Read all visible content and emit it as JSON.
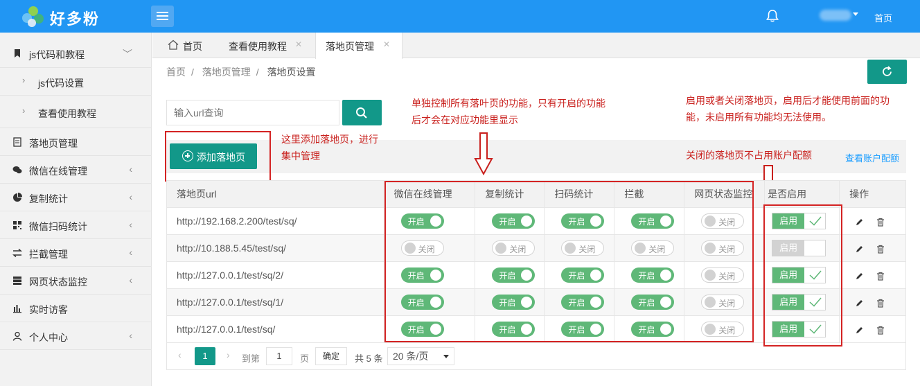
{
  "app": {
    "logo_text": "好多粉",
    "top_home": "首页"
  },
  "sidebar": {
    "items": [
      {
        "label": "js代码和教程",
        "icon": "bookmark-icon"
      },
      {
        "label": "js代码设置"
      },
      {
        "label": "查看使用教程"
      },
      {
        "label": "落地页管理",
        "icon": "document-icon"
      },
      {
        "label": "微信在线管理",
        "icon": "wechat-icon"
      },
      {
        "label": "复制统计",
        "icon": "pie-chart-icon"
      },
      {
        "label": "微信扫码统计",
        "icon": "qrcode-icon"
      },
      {
        "label": "拦截管理",
        "icon": "swap-icon"
      },
      {
        "label": "网页状态监控",
        "icon": "server-icon"
      },
      {
        "label": "实时访客",
        "icon": "bar-chart-icon"
      },
      {
        "label": "个人中心",
        "icon": "user-icon"
      }
    ]
  },
  "tabs": [
    {
      "label": "首页"
    },
    {
      "label": "查看使用教程"
    },
    {
      "label": "落地页管理",
      "active": true
    }
  ],
  "breadcrumb": [
    "首页",
    "落地页管理",
    "落地页设置"
  ],
  "search": {
    "placeholder": "输入url查询"
  },
  "toolbar": {
    "add_label": "添加落地页",
    "quota_link": "查看账户配额"
  },
  "annotations": {
    "add": "这里添加落地页，进行集中管理",
    "features": "单独控制所有落叶页的功能，只有开启的功能后才会在对应功能里显示",
    "enable": "启用或者关闭落地页，启用后才能使用前面的功能，未启用所有功能均无法使用。",
    "quota": "关闭的落地页不占用账户配额"
  },
  "table": {
    "headers": [
      "落地页url",
      "微信在线管理",
      "复制统计",
      "扫码统计",
      "拦截",
      "网页状态监控",
      "是否启用",
      "操作"
    ],
    "on_label": "开启",
    "off_label": "关闭",
    "enable_label": "启用",
    "rows": [
      {
        "url": "http://192.168.2.200/test/sq/",
        "switches": [
          true,
          true,
          true,
          true,
          false
        ],
        "enabled": true
      },
      {
        "url": "http://10.188.5.45/test/sq/",
        "switches": [
          false,
          false,
          false,
          false,
          false
        ],
        "enabled": false
      },
      {
        "url": "http://127.0.0.1/test/sq/2/",
        "switches": [
          true,
          true,
          true,
          true,
          false
        ],
        "enabled": true
      },
      {
        "url": "http://127.0.0.1/test/sq/1/",
        "switches": [
          true,
          true,
          true,
          true,
          false
        ],
        "enabled": true
      },
      {
        "url": "http://127.0.0.1/test/sq/",
        "switches": [
          true,
          true,
          true,
          true,
          false
        ],
        "enabled": true
      }
    ]
  },
  "pager": {
    "current_page": "1",
    "goto_label": "到第",
    "goto_value": "1",
    "page_unit": "页",
    "confirm": "确定",
    "total": "共 5 条",
    "page_size": "20 条/页"
  },
  "colors": {
    "topbar": "#2196f3",
    "primary": "#129889",
    "switch_on": "#5fb878",
    "annotation": "#c9201d"
  }
}
